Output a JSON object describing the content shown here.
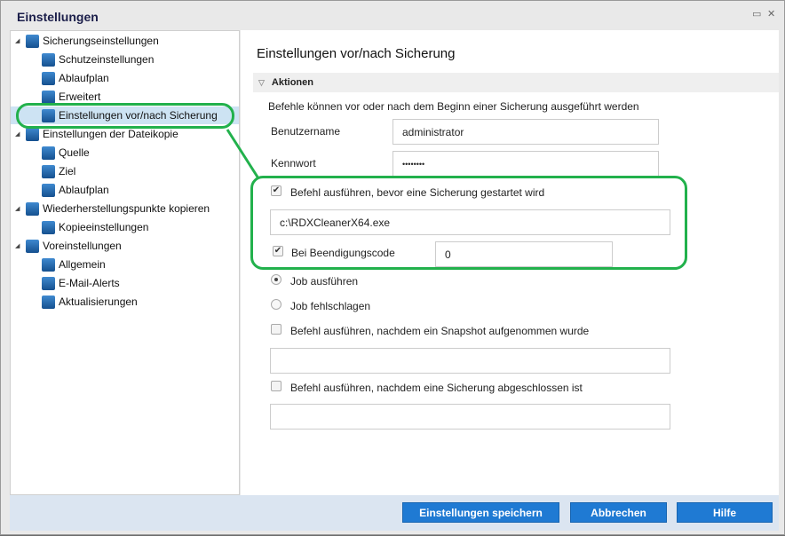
{
  "window": {
    "title": "Einstellungen",
    "restore_icon": "▭",
    "close_icon": "✕"
  },
  "tree": [
    {
      "label": "Sicherungseinstellungen",
      "level": 0
    },
    {
      "label": "Schutzeinstellungen",
      "level": 1
    },
    {
      "label": "Ablaufplan",
      "level": 1
    },
    {
      "label": "Erweitert",
      "level": 1
    },
    {
      "label": "Einstellungen vor/nach Sicherung",
      "level": 1,
      "selected": true
    },
    {
      "label": "Einstellungen der Dateikopie",
      "level": 0
    },
    {
      "label": "Quelle",
      "level": 1
    },
    {
      "label": "Ziel",
      "level": 1
    },
    {
      "label": "Ablaufplan",
      "level": 1
    },
    {
      "label": "Wiederherstellungspunkte kopieren",
      "level": 0
    },
    {
      "label": "Kopieeinstellungen",
      "level": 1
    },
    {
      "label": "Voreinstellungen",
      "level": 0
    },
    {
      "label": "Allgemein",
      "level": 1
    },
    {
      "label": "E-Mail-Alerts",
      "level": 1
    },
    {
      "label": "Aktualisierungen",
      "level": 1
    }
  ],
  "main": {
    "heading": "Einstellungen vor/nach Sicherung",
    "section": "Aktionen",
    "description": "Befehle können vor oder nach dem Beginn einer Sicherung ausgeführt werden",
    "username_label": "Benutzername",
    "username_value": "administrator",
    "password_label": "Kennwort",
    "password_value": "••••••••",
    "pre_cmd_label": "Befehl ausführen, bevor eine Sicherung gestartet wird",
    "pre_cmd_checked": true,
    "pre_cmd_value": "c:\\RDXCleanerX64.exe",
    "exit_code_label": "Bei Beendigungscode",
    "exit_code_checked": true,
    "exit_code_value": "0",
    "radio_run": "Job ausführen",
    "radio_fail": "Job fehlschlagen",
    "snapshot_cmd_label": "Befehl ausführen, nachdem ein Snapshot aufgenommen wurde",
    "snapshot_cmd_value": "",
    "post_cmd_label": "Befehl ausführen, nachdem eine Sicherung abgeschlossen ist",
    "post_cmd_value": ""
  },
  "footer": {
    "save": "Einstellungen speichern",
    "cancel": "Abbrechen",
    "help": "Hilfe"
  },
  "annotation_color": "#22b14c"
}
